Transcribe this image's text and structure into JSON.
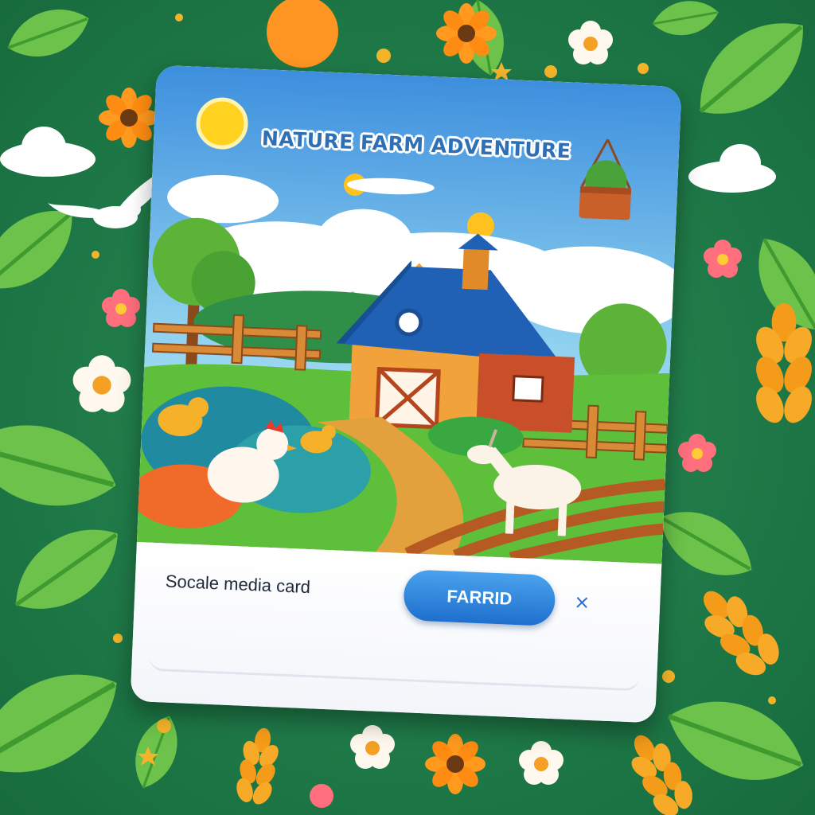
{
  "card": {
    "title": "NATURE FARM ADVENTURE",
    "caption": "Socale media card",
    "action_label": "FARRID",
    "close_symbol": "×"
  },
  "colors": {
    "background": "#1f7a4a",
    "title": "#2f6fb5",
    "button": "#2a7fde",
    "close": "#2b6fd0"
  },
  "icons": [
    "flower-icon",
    "leaf-icon",
    "wheat-icon",
    "cloud-icon",
    "dove-icon",
    "sun-icon",
    "hanging-basket-icon",
    "barn-icon",
    "chicken-icon",
    "chick-icon",
    "goat-icon",
    "close-icon"
  ]
}
